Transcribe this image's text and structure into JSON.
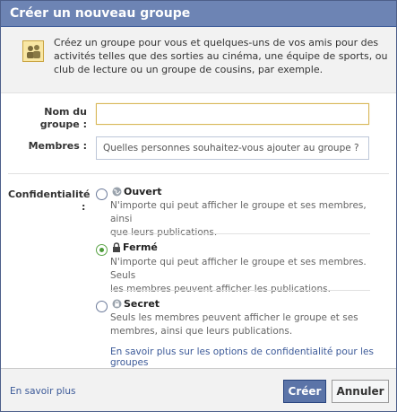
{
  "dialog": {
    "title": "Créer un nouveau groupe",
    "intro_icon": "group-icon",
    "intro_text": "Créez un groupe pour vous et quelques-uns de vos amis pour des activités telles que des sorties au cinéma, une équipe de sports, ou club de lecture ou un groupe de cousins, par exemple."
  },
  "form": {
    "name_label_line1": "Nom du",
    "name_label_line2": "groupe :",
    "name_value": "",
    "members_label": "Membres :",
    "members_placeholder": "Quelles personnes souhaitez-vous ajouter au groupe ?"
  },
  "privacy": {
    "label_line1": "Confidentialité",
    "label_line2": ":",
    "selected": "ferme",
    "options": [
      {
        "id": "ouvert",
        "icon": "globe-icon",
        "title": "Ouvert",
        "desc_line1": "N'importe qui peut afficher le groupe et ses membres, ainsi",
        "desc_line2": "que leurs publications."
      },
      {
        "id": "ferme",
        "icon": "lock-icon",
        "title": "Fermé",
        "desc_line1": "N'importe qui peut afficher le groupe et ses membres. Seuls",
        "desc_line2": "les membres peuvent afficher les publications."
      },
      {
        "id": "secret",
        "icon": "lock-circle-icon",
        "title": "Secret",
        "desc_line1": "Seuls les membres peuvent afficher le groupe et ses",
        "desc_line2": "membres, ainsi que leurs publications."
      }
    ],
    "more_link": "En savoir plus sur les options de confidentialité pour les groupes"
  },
  "footer": {
    "learn_more": "En savoir plus",
    "create_label": "Créer",
    "cancel_label": "Annuler"
  },
  "colors": {
    "titlebar": "#6d84b4",
    "link": "#3b5998",
    "primary_button": "#5b74a8",
    "radio_checked": "#4b9b38"
  }
}
